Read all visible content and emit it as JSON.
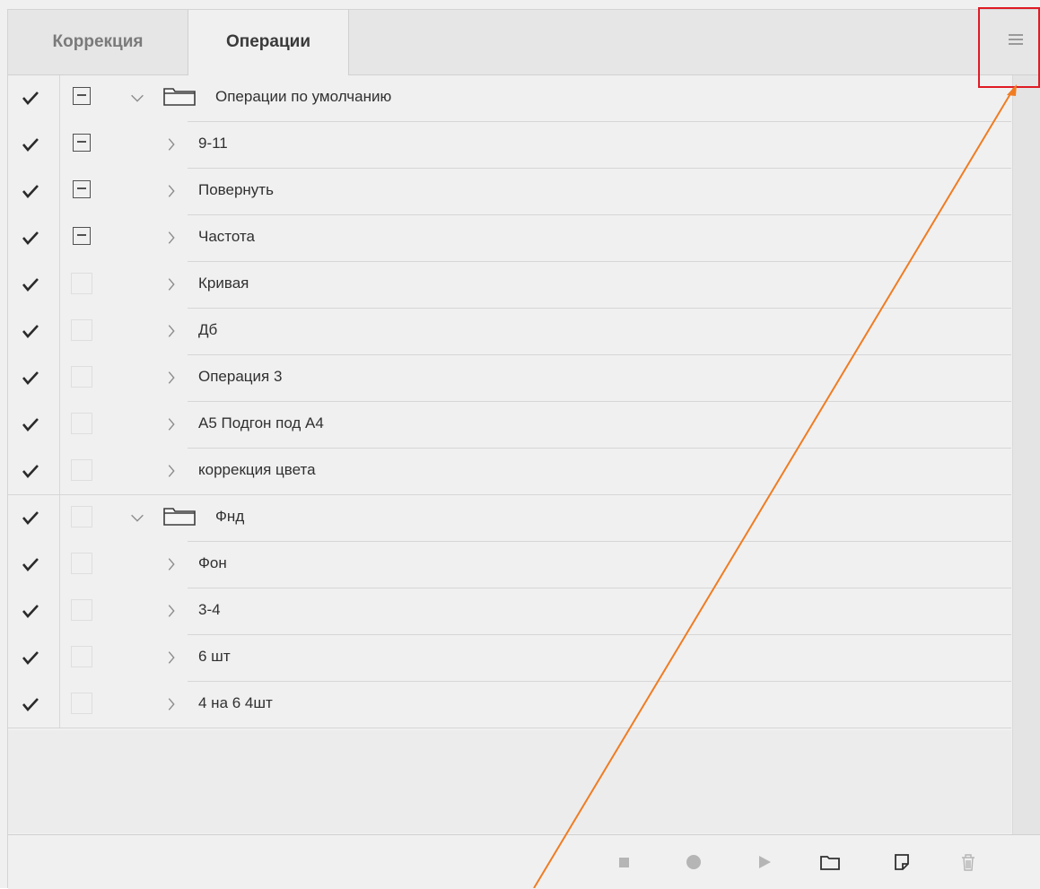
{
  "tabs": [
    {
      "label": "Коррекция",
      "active": false
    },
    {
      "label": "Операции",
      "active": true
    }
  ],
  "panel_menu": {
    "icon": "hamburger-menu-icon"
  },
  "actions": [
    {
      "label": "Операции по умолчанию",
      "type": "set",
      "checked": true,
      "dialog": true,
      "expanded": true
    },
    {
      "label": "9-11",
      "type": "action",
      "checked": true,
      "dialog": true,
      "expanded": false
    },
    {
      "label": "Повернуть",
      "type": "action",
      "checked": true,
      "dialog": true,
      "expanded": false
    },
    {
      "label": "Частота",
      "type": "action",
      "checked": true,
      "dialog": true,
      "expanded": false
    },
    {
      "label": "Кривая",
      "type": "action",
      "checked": true,
      "dialog": false,
      "expanded": false
    },
    {
      "label": "Дб",
      "type": "action",
      "checked": true,
      "dialog": false,
      "expanded": false
    },
    {
      "label": "Операция 3",
      "type": "action",
      "checked": true,
      "dialog": false,
      "expanded": false
    },
    {
      "label": "А5 Подгон под А4",
      "type": "action",
      "checked": true,
      "dialog": false,
      "expanded": false
    },
    {
      "label": "коррекция цвета",
      "type": "action",
      "checked": true,
      "dialog": false,
      "expanded": false
    },
    {
      "label": "Фнд",
      "type": "set",
      "checked": true,
      "dialog": false,
      "expanded": true
    },
    {
      "label": "Фон",
      "type": "action",
      "checked": true,
      "dialog": false,
      "expanded": false
    },
    {
      "label": "3-4",
      "type": "action",
      "checked": true,
      "dialog": false,
      "expanded": false
    },
    {
      "label": "6 шт",
      "type": "action",
      "checked": true,
      "dialog": false,
      "expanded": false
    },
    {
      "label": "4 на 6 4шт",
      "type": "action",
      "checked": true,
      "dialog": false,
      "expanded": false
    }
  ],
  "toolbar": [
    {
      "icon": "stop-icon"
    },
    {
      "icon": "record-icon"
    },
    {
      "icon": "play-icon"
    },
    {
      "icon": "new-set-folder-icon"
    },
    {
      "icon": "new-action-icon"
    },
    {
      "icon": "delete-trash-icon"
    }
  ],
  "colors": {
    "highlight": "#e01b24",
    "annotation_arrow": "#f07c22",
    "panel_bg": "#f0f0f0"
  }
}
